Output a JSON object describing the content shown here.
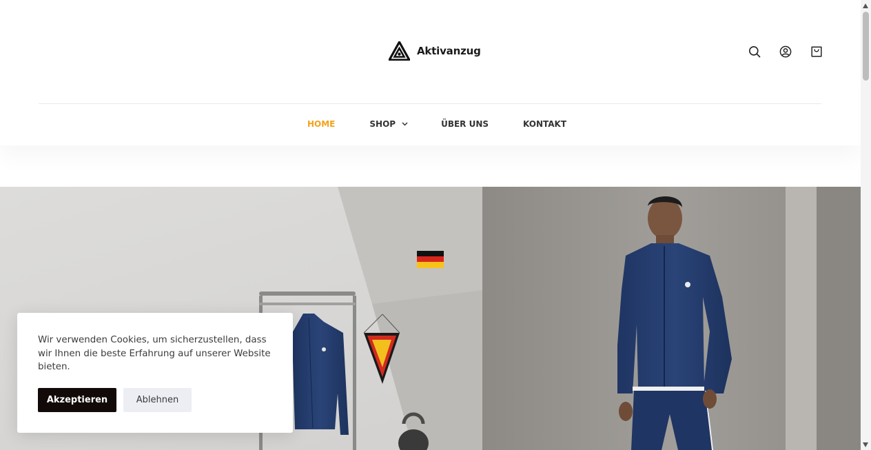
{
  "brand": {
    "name": "Aktivanzug",
    "logo_icon": "triangle-logo-icon"
  },
  "header_icons": [
    {
      "name": "search-icon",
      "label": "Search"
    },
    {
      "name": "account-icon",
      "label": "Account"
    },
    {
      "name": "cart-icon",
      "label": "Cart"
    }
  ],
  "nav": {
    "home": "HOME",
    "shop": "SHOP",
    "about": "ÜBER UNS",
    "contact": "KONTAKT",
    "active_color": "#f4a21a"
  },
  "cookie": {
    "message": "Wir verwenden Cookies, um sicherzustellen, dass wir Ihnen die beste Erfahrung auf unserer Website bieten.",
    "accept": "Akzeptieren",
    "decline": "Ablehnen"
  }
}
